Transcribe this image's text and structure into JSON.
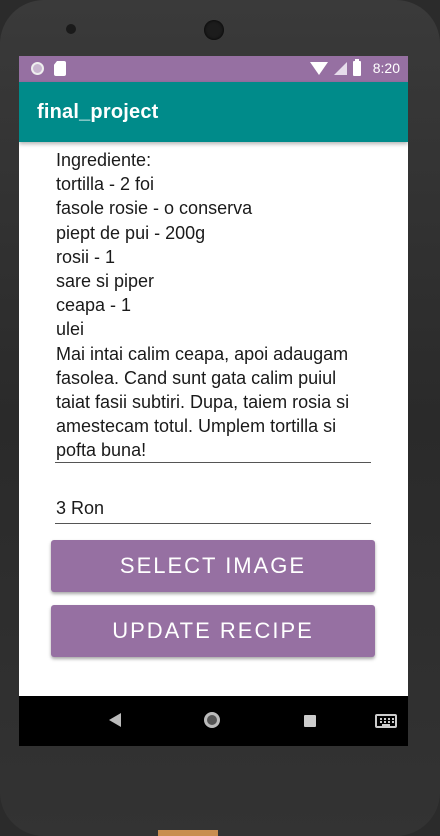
{
  "status_bar": {
    "time": "8:20",
    "icons": [
      "notification-circle-icon",
      "sd-card-icon",
      "wifi-icon",
      "signal-icon",
      "battery-icon"
    ]
  },
  "app_bar": {
    "title": "final_project"
  },
  "recipe": {
    "description": "Ingrediente:\ntortilla - 2 foi\nfasole rosie - o conserva\npiept de pui - 200g\nrosii - 1\nsare si piper\nceapa - 1\nulei\nMai intai calim ceapa, apoi adaugam fasolea. Cand sunt gata calim puiul taiat fasii subtiri. Dupa, taiem rosia si amestecam totul. Umplem tortilla si pofta buna!",
    "price": "3 Ron"
  },
  "buttons": {
    "select_image": "SELECT IMAGE",
    "update_recipe": "UPDATE RECIPE"
  },
  "nav_bar": {
    "icons": [
      "back-icon",
      "home-icon",
      "recents-icon",
      "keyboard-icon"
    ]
  },
  "colors": {
    "status_bar": "#9670a2",
    "app_bar": "#008b8a",
    "button": "#9670a2"
  }
}
